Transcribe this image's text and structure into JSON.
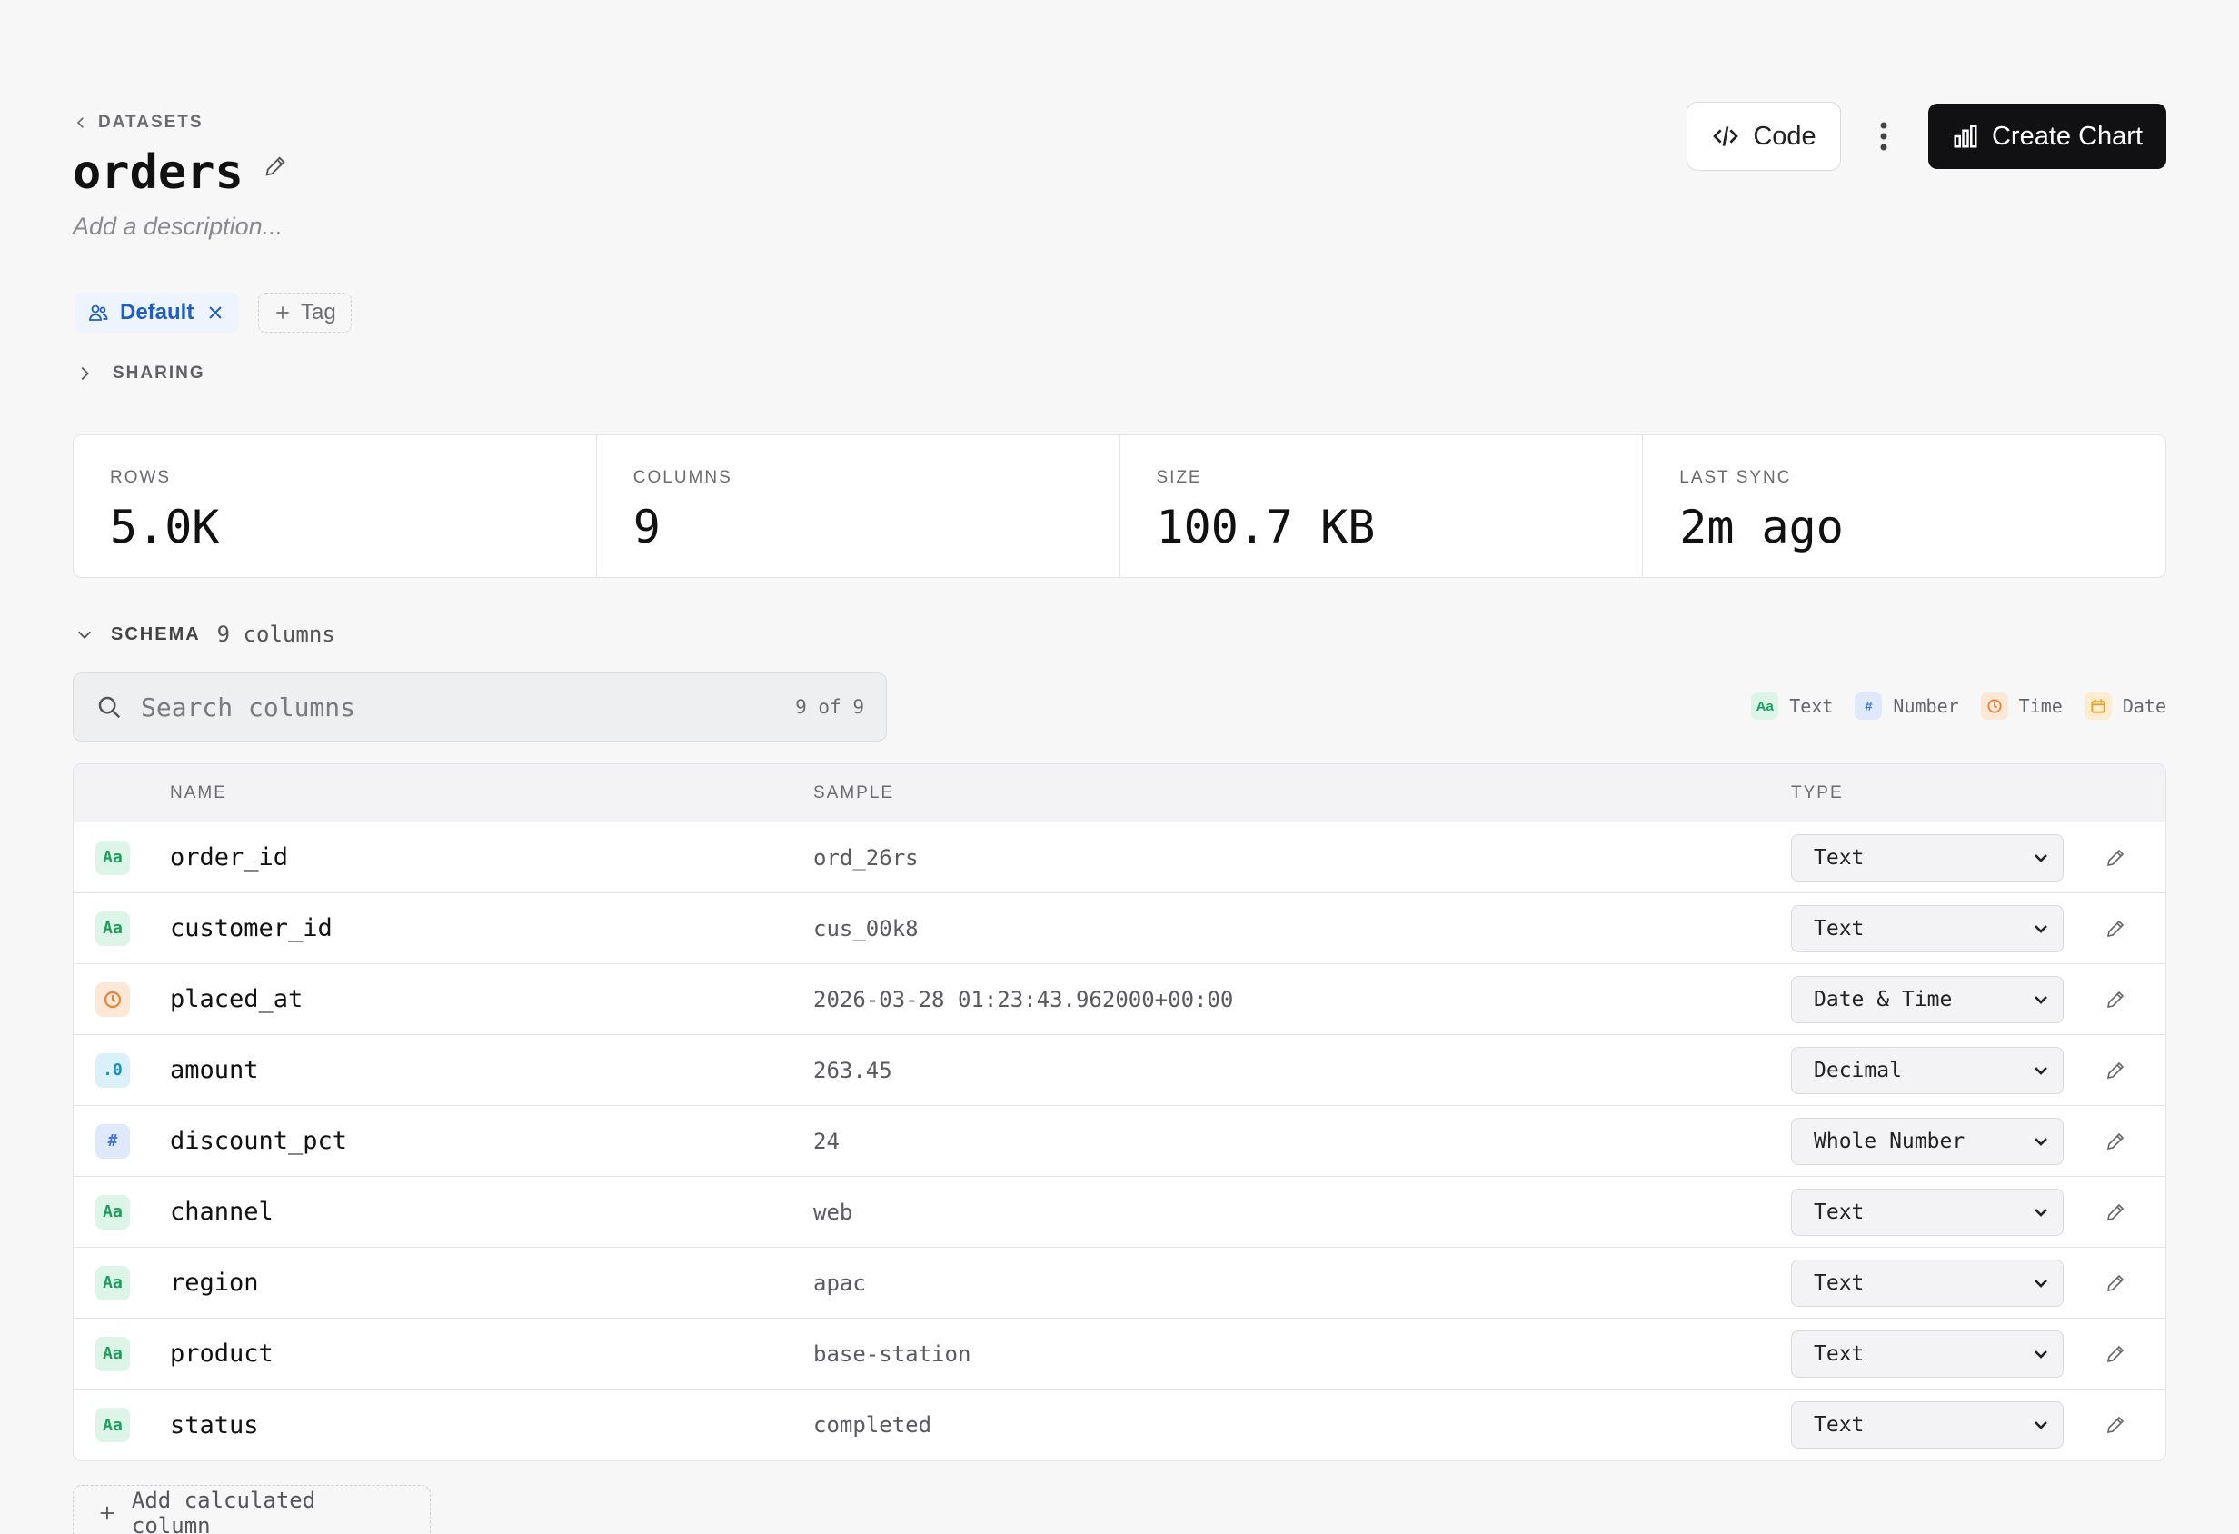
{
  "breadcrumb": {
    "label": "DATASETS"
  },
  "dataset": {
    "title": "orders",
    "description_placeholder": "Add a description..."
  },
  "actions": {
    "code_label": "Code",
    "create_chart_label": "Create Chart"
  },
  "tags": {
    "items": [
      {
        "label": "Default"
      }
    ],
    "add_label": "Tag"
  },
  "sharing": {
    "label": "SHARING"
  },
  "stats": [
    {
      "label": "ROWS",
      "value": "5.0K"
    },
    {
      "label": "COLUMNS",
      "value": "9"
    },
    {
      "label": "SIZE",
      "value": "100.7 KB"
    },
    {
      "label": "LAST SYNC",
      "value": "2m ago"
    }
  ],
  "schema": {
    "label": "SCHEMA",
    "count_label": "9 columns",
    "search": {
      "placeholder": "Search columns",
      "value": "",
      "count": "9 of 9"
    },
    "legend": [
      {
        "badge": "Aa",
        "label": "Text",
        "icon": "text-icon"
      },
      {
        "badge": "#",
        "label": "Number",
        "icon": "number-icon"
      },
      {
        "badge": "",
        "label": "Time",
        "icon": "clock-icon"
      },
      {
        "badge": "",
        "label": "Date",
        "icon": "calendar-icon"
      }
    ],
    "headers": {
      "name": "NAME",
      "sample": "SAMPLE",
      "type": "TYPE"
    },
    "rows": [
      {
        "badge": "Aa",
        "kind": "text",
        "name": "order_id",
        "sample": "ord_26rs",
        "type": "Text"
      },
      {
        "badge": "Aa",
        "kind": "text",
        "name": "customer_id",
        "sample": "cus_00k8",
        "type": "Text"
      },
      {
        "badge": "",
        "kind": "time",
        "name": "placed_at",
        "sample": "2026-03-28 01:23:43.962000+00:00",
        "type": "Date & Time"
      },
      {
        "badge": ".0",
        "kind": "decimal",
        "name": "amount",
        "sample": "263.45",
        "type": "Decimal"
      },
      {
        "badge": "#",
        "kind": "number",
        "name": "discount_pct",
        "sample": "24",
        "type": "Whole Number"
      },
      {
        "badge": "Aa",
        "kind": "text",
        "name": "channel",
        "sample": "web",
        "type": "Text"
      },
      {
        "badge": "Aa",
        "kind": "text",
        "name": "region",
        "sample": "apac",
        "type": "Text"
      },
      {
        "badge": "Aa",
        "kind": "text",
        "name": "product",
        "sample": "base-station",
        "type": "Text"
      },
      {
        "badge": "Aa",
        "kind": "text",
        "name": "status",
        "sample": "completed",
        "type": "Text"
      }
    ],
    "add_calculated_label": "Add calculated column"
  },
  "colors": {
    "primary_button": "#111113",
    "tag_blue": "#1f5fbf",
    "text_badge": "#1f9d5c",
    "number_badge": "#3d78d8",
    "time_badge": "#e8843a",
    "date_badge": "#e5a133"
  }
}
